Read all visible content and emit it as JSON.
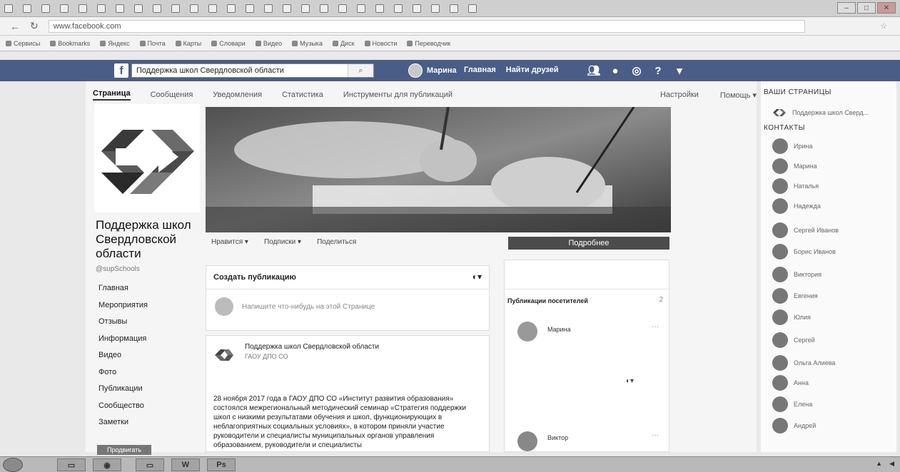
{
  "browser": {
    "url": "www.facebook.com",
    "bookmarks": [
      "Сервисы",
      "Bookmarks",
      "Яндекс",
      "Почта",
      "Карты",
      "Словари",
      "Видео",
      "Музыка",
      "Диск",
      "Новости",
      "Переводчик"
    ]
  },
  "fb": {
    "search_value": "Поддержка школ Свердловской области",
    "user_name": "Марина",
    "nav": [
      "Главная",
      "Найти друзей"
    ],
    "icons": [
      "friends-icon",
      "messenger-icon",
      "globe-icon",
      "help-icon"
    ]
  },
  "pagenav": {
    "tabs": [
      "Страница",
      "Сообщения",
      "Уведомления",
      "Статистика",
      "Инструменты для публикаций"
    ],
    "settings": "Настройки",
    "help": "Помощь ▾"
  },
  "page": {
    "name_line1": "Поддержка школ",
    "name_line2": "Свердловской",
    "name_line3": "области",
    "handle": "@supSchools",
    "leftnav": [
      "Главная",
      "Мероприятия",
      "Отзывы",
      "Информация",
      "Видео",
      "Фото",
      "Публикации",
      "Сообщество",
      "Заметки"
    ],
    "promote": "Продвигать"
  },
  "actions": {
    "like": "Нравится ▾",
    "follow": "Подписки ▾",
    "share": "Поделиться",
    "more": "Подробнее"
  },
  "composer": {
    "title": "Создать публикацию",
    "placeholder": "Напишите что-нибудь на этой Странице"
  },
  "post": {
    "author": "Поддержка школ Свердловской области",
    "meta": "ГАОУ ДПО СО",
    "body": "28 ноября 2017 года в ГАОУ ДПО СО «Институт развития образования» состоялся межрегиональный методический семинар «Стратегия поддержки школ с низкими результатами обучения и школ, функционирующих в неблагоприятных социальных условиях», в котором приняли участие руководители и специалисты муниципальных органов управления образованием, руководители и специалисты"
  },
  "rpanel": {
    "visitor_title": "Публикации посетителей",
    "visitor_count": "2",
    "visitor1": "Марина",
    "visitor2": "Виктор"
  },
  "sidebar": {
    "pages_title": "ВАШИ СТРАНИЦЫ",
    "page_item": "Поддержка школ Сверд...",
    "contacts_title": "КОНТАКТЫ",
    "contacts": [
      "Ирина",
      "Марина",
      "Наталья",
      "Надежда",
      "Сергей Иванов",
      "Борис Иванов",
      "Виктория",
      "Евгения",
      "Юлия",
      "Сергей",
      "Ольга Алиева",
      "Анна",
      "Елена",
      "Андрей"
    ]
  },
  "colors": {
    "fb_bar": "#4a5d86",
    "more_btn": "#4c4c4c"
  }
}
